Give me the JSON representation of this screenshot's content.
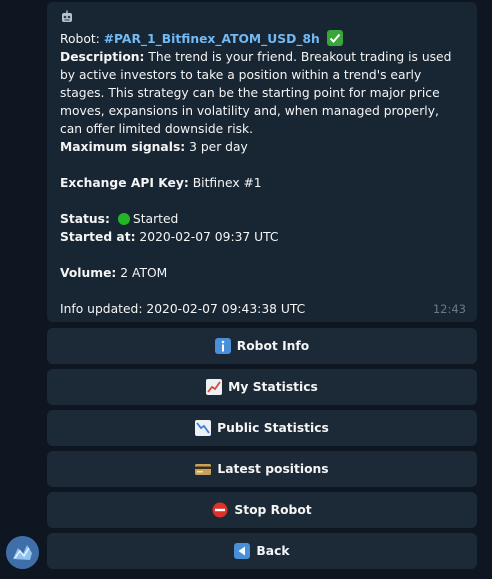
{
  "message": {
    "robot_label": "Robot:",
    "robot_name": "#PAR_1_Bitfinex_ATOM_USD_8h",
    "description_label": "Description:",
    "description_text": "The trend is your friend. Breakout trading is used by active investors to take a position within a trend's early stages. This strategy can be the starting point for major price moves, expansions in volatility and, when managed properly, can offer limited downside risk.",
    "max_signals_label": "Maximum signals:",
    "max_signals_value": "3 per day",
    "api_key_label": "Exchange API Key:",
    "api_key_value": "Bitfinex #1",
    "status_label": "Status:",
    "status_value": "Started",
    "started_at_label": "Started at:",
    "started_at_value": "2020-02-07 09:37 UTC",
    "volume_label": "Volume:",
    "volume_value": "2 ATOM",
    "info_updated": "Info updated: 2020-02-07 09:43:38 UTC",
    "time": "12:43"
  },
  "keyboard": {
    "robot_info": "Robot Info",
    "my_statistics": "My Statistics",
    "public_statistics": "Public Statistics",
    "latest_positions": "Latest positions",
    "stop_robot": "Stop Robot",
    "back": "Back"
  },
  "icons": {
    "robot": "robot-icon",
    "check": "check-mark-icon",
    "status": "green-circle-icon",
    "info": "info-icon",
    "chart_up": "chart-increasing-icon",
    "chart_down": "chart-decreasing-icon",
    "card": "credit-card-icon",
    "stop": "no-entry-icon",
    "back": "back-arrow-icon"
  },
  "colors": {
    "background": "#0e1621",
    "bubble": "#182533",
    "button": "#1c2a38",
    "link": "#71baf4",
    "status_green": "#22b825"
  }
}
